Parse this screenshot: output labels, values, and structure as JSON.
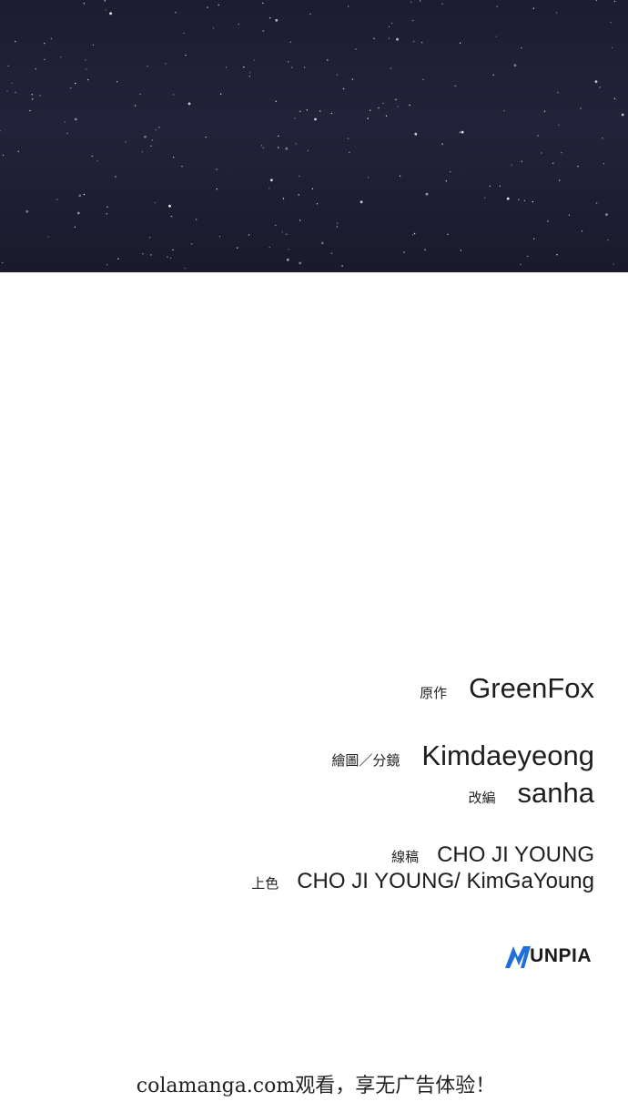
{
  "credits": [
    {
      "role": "原作",
      "name": "GreenFox"
    },
    {
      "role": "繪圖／分鏡",
      "name": "Kimdaeyeong"
    },
    {
      "role": "改編",
      "name": "sanha"
    },
    {
      "role": "線稿",
      "name": "CHO JI YOUNG"
    },
    {
      "role": "上色",
      "name": "CHO JI YOUNG/ KimGaYoung"
    }
  ],
  "logo": {
    "text": "UNPIA",
    "accent_color": "#1f6fd8"
  },
  "watermark": "colamanga.com观看，享无广告体验！",
  "colors": {
    "sky": "#1f1e33",
    "background": "#ffffff"
  }
}
